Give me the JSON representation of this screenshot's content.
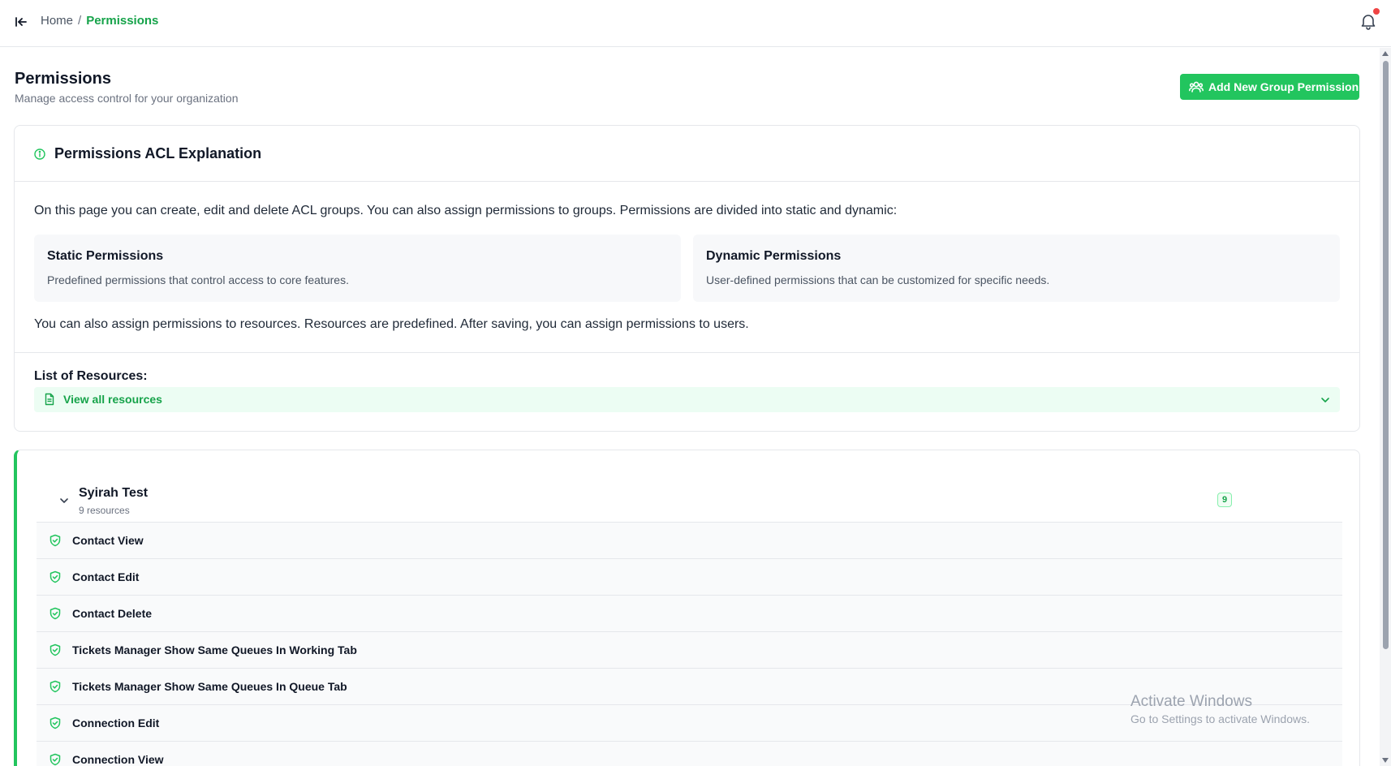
{
  "header": {
    "breadcrumb": {
      "home": "Home",
      "separator": "/",
      "current": "Permissions"
    },
    "notification_dot": true,
    "colors": {
      "accent": "#22c55e",
      "accent_text": "#16a34a",
      "dot": "#ef4444"
    }
  },
  "page": {
    "title": "Permissions",
    "subtitle": "Manage access control for your organization",
    "add_button_label": "Add New Group Permission"
  },
  "acl": {
    "title": "Permissions ACL Explanation",
    "intro": "On this page you can create, edit and delete ACL groups. You can also assign permissions to groups. Permissions are divided into static and dynamic:",
    "static": {
      "title": "Static Permissions",
      "desc": "Predefined permissions that control access to core features."
    },
    "dynamic": {
      "title": "Dynamic Permissions",
      "desc": "User-defined permissions that can be customized for specific needs."
    },
    "outro": "You can also assign permissions to resources. Resources are predefined. After saving, you can assign permissions to users.",
    "resources_label": "List of Resources:",
    "view_all_label": "View all resources"
  },
  "group": {
    "name": "Syirah Test",
    "count_label": "9 resources",
    "badge": "9",
    "resources": [
      "Contact View",
      "Contact Edit",
      "Contact Delete",
      "Tickets Manager Show Same Queues In Working Tab",
      "Tickets Manager Show Same Queues In Queue Tab",
      "Connection Edit",
      "Connection View"
    ]
  },
  "watermark": {
    "line1": "Activate Windows",
    "line2": "Go to Settings to activate Windows."
  }
}
